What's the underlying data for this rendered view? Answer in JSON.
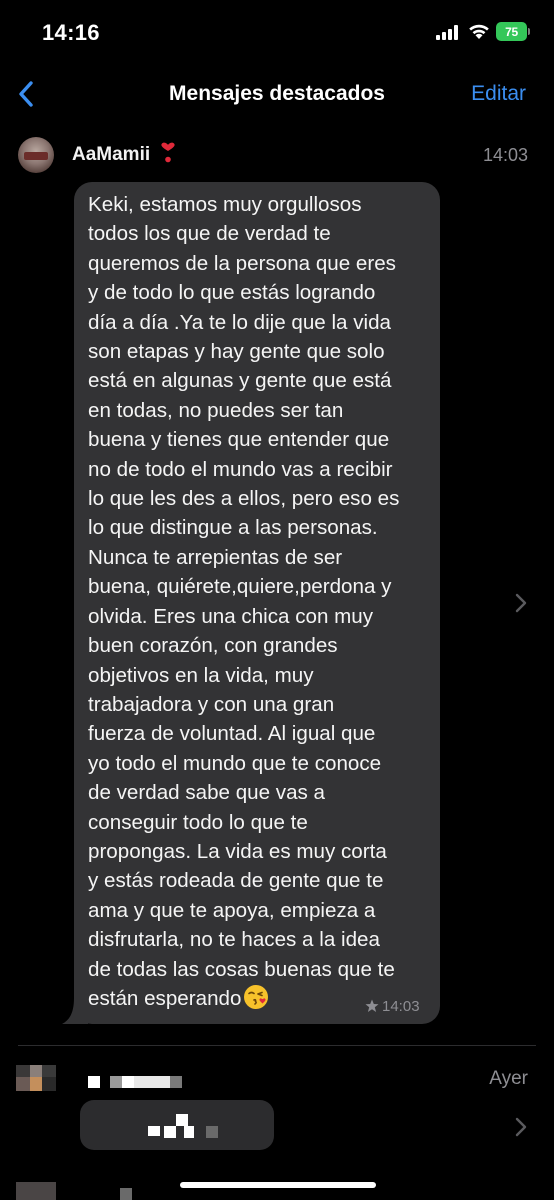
{
  "status_bar": {
    "time": "14:16",
    "battery": "75",
    "signal_icon": "cellular-signal-icon",
    "wifi_icon": "wifi-icon",
    "battery_icon": "battery-charging-icon",
    "battery_color": "#34c759"
  },
  "nav": {
    "back_icon": "chevron-left-icon",
    "title": "Mensajes destacados",
    "edit_label": "Editar",
    "accent_color": "#3b8ef0"
  },
  "starred_messages": [
    {
      "sender": "AaMamii",
      "sender_emoji": "heart-exclamation-icon",
      "time": "14:03",
      "text": "Keki, estamos muy orgullosos\ntodos los que de verdad te\nqueremos de la persona que eres\ny de todo lo que estás logrando\ndía a día .Ya te lo dije que la vida\nson etapas y hay gente que solo\nestá en algunas y gente que está\nen todas, no puedes ser tan\nbuena y tienes que entender que\nno de todo el mundo vas a recibir\nlo que les des a ellos, pero eso es\nlo que distingue a las personas.\nNunca te arrepientas de ser\nbuena, quiérete,quiere,perdona y\nolvida. Eres una chica con muy\nbuen corazón, con grandes\nobjetivos en la vida, muy\ntrabajadora y con una gran\nfuerza de voluntad. Al igual que\nyo todo el mundo que te conoce\nde verdad sabe que vas a\nconseguir todo lo que te\npropongas. La vida es muy corta\ny estás rodeada de gente que te\nama y que te apoya, empieza a\ndisfrutarla, no te haces a la idea\nde todas las cosas buenas que te\nestán esperando",
      "trailing_emoji": "face-blowing-kiss-icon",
      "bubble_time": "14:03",
      "starred_icon": "star-icon"
    },
    {
      "sender": "",
      "time": "Ayer"
    }
  ]
}
